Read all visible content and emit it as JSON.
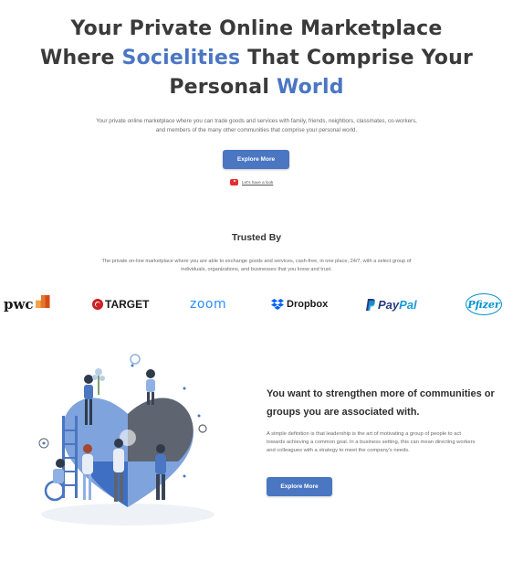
{
  "hero": {
    "title_line1": "Your Private Online Marketplace",
    "title_line2_a": "Where ",
    "title_line2_accent": "Socielities",
    "title_line2_b": " That Comprise Your",
    "title_line3_a": "Personal ",
    "title_line3_accent": "World",
    "description": "Your private online marketplace where you can trade goods and services with family, friends, neighbors, classmates, co-workers, and members of the many other communities that comprise your personal world.",
    "button_label": "Explore More",
    "video_link": "Let's have a look"
  },
  "trusted": {
    "title": "Trusted By",
    "description": "The private on-line marketplace where you are able to exchange goods and services, cash-free, in one place, 24/7, with a select group of individuals, organizations, and businesses that you know and trust.",
    "logos": [
      {
        "name": "pwc",
        "label": "pwc"
      },
      {
        "name": "target",
        "label": "TARGET"
      },
      {
        "name": "zoom",
        "label": "zoom"
      },
      {
        "name": "dropbox",
        "label": "Dropbox"
      },
      {
        "name": "paypal",
        "label_a": "Pay",
        "label_b": "Pal"
      },
      {
        "name": "pfizer",
        "label": "Pfizer"
      }
    ]
  },
  "feature": {
    "title": "You want to strengthen more of communities or groups you are associated with.",
    "description": "A simple definition is that leadership is the art of motivating a group of people to act towards achieving a common goal. In a business setting, this can mean directing workers and colleagues with a strategy to meet the company's needs.",
    "button_label": "Explore More"
  },
  "colors": {
    "accent": "#4a76c2",
    "heading": "#3a3a3a",
    "body_text": "#6b6b6b",
    "youtube_red": "#e0302f"
  },
  "icons": [
    "youtube-play-icon",
    "target-logo-icon",
    "dropbox-logo-icon",
    "paypal-logo-icon"
  ]
}
